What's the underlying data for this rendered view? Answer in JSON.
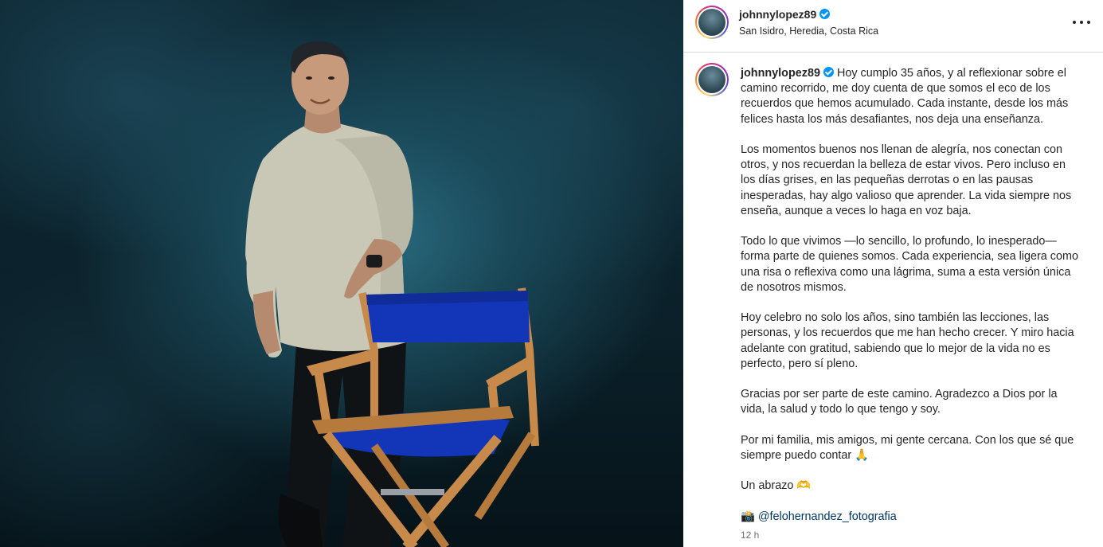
{
  "post": {
    "username": "johnnylopez89",
    "location": "San Isidro, Heredia, Costa Rica",
    "caption": {
      "p1": "Hoy cumplo 35 años, y al reflexionar sobre el camino recorrido, me doy cuenta de que somos el eco de los recuerdos que hemos acumulado. Cada instante, desde los más felices hasta los más desafiantes, nos deja una enseñanza.",
      "p2": "Los momentos buenos nos llenan de alegría, nos conectan con otros, y nos recuerdan la belleza de estar vivos. Pero incluso en los días grises, en las pequeñas derrotas o en las pausas inesperadas, hay algo valioso que aprender. La vida siempre nos enseña, aunque a veces lo haga en voz baja.",
      "p3": "Todo lo que vivimos —lo sencillo, lo profundo, lo inesperado— forma parte de quienes somos. Cada experiencia, sea ligera como una risa o reflexiva como una lágrima, suma a esta versión única de nosotros mismos.",
      "p4": "Hoy celebro no solo los años, sino también las lecciones, las personas, y los recuerdos que me han hecho crecer. Y miro hacia adelante con gratitud, sabiendo que lo mejor de la vida no es perfecto, pero sí pleno.",
      "p5": "Gracias por ser parte de este camino. Agradezco a Dios por la vida, la salud y todo lo que tengo y soy.",
      "p6": "Por mi familia, mis amigos, mi gente cercana. Con los que sé que siempre puedo contar 🙏",
      "p7": "Un abrazo 🫶",
      "camera_emoji": "📸",
      "mention": "@felohernandez_fotografia"
    },
    "time": "12 h"
  },
  "icons": {
    "verified": "verified-badge-icon",
    "more": "more-options-icon"
  },
  "colors": {
    "verified": "#0095f6",
    "text": "#262626",
    "muted": "#737373",
    "mention": "#00376b",
    "chair": "#1336b8",
    "wood": "#c88a4a"
  }
}
